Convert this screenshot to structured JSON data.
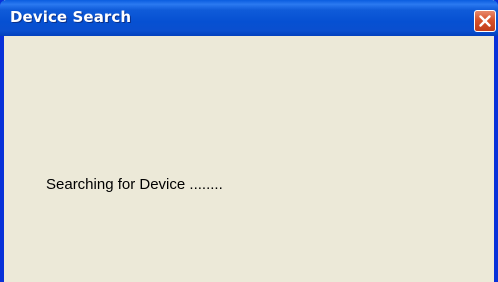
{
  "window": {
    "title": "Device Search",
    "close_icon": "close-x-icon",
    "accent_color": "#0831d9",
    "close_color": "#d8532b",
    "background_color": "#ece9d8"
  },
  "content": {
    "status_message": "Searching for Device ........"
  }
}
